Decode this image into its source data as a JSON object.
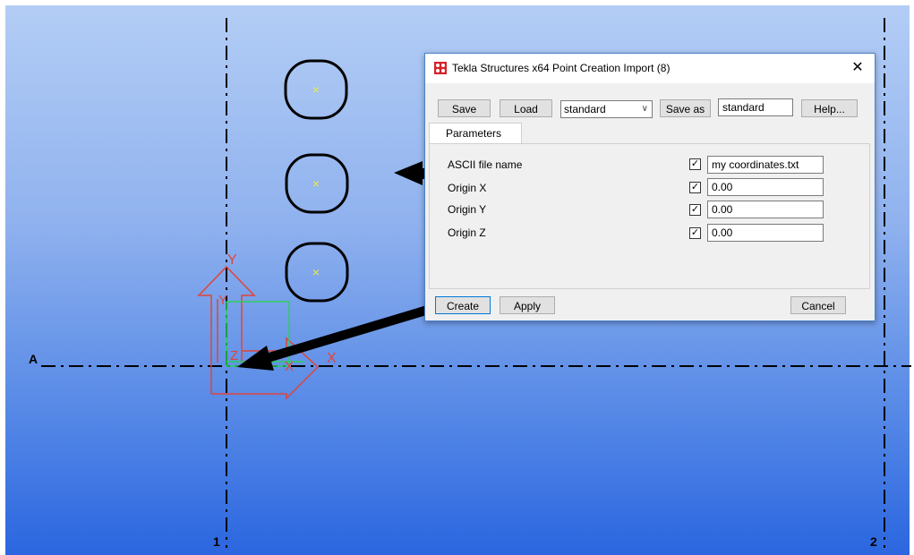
{
  "grid": {
    "axis_a": "A",
    "axis_1": "1",
    "axis_2": "2"
  },
  "coordinate_symbol": {
    "y_label": "Y",
    "x_label": "X",
    "z_label": "Z"
  },
  "points": [
    {
      "marker": "×"
    },
    {
      "marker": "×"
    },
    {
      "marker": "×"
    }
  ],
  "dialog": {
    "title": "Tekla Structures x64  Point Creation Import (8)",
    "close": "✕",
    "toolbar": {
      "save_label": "Save",
      "load_label": "Load",
      "preset_value": "standard",
      "save_as_label": "Save as",
      "save_as_value": "standard",
      "help_label": "Help..."
    },
    "tab": "Parameters",
    "params": [
      {
        "label": "ASCII file name",
        "checked": true,
        "value": "my coordinates.txt"
      },
      {
        "label": "Origin X",
        "checked": true,
        "value": "0.00"
      },
      {
        "label": "Origin Y",
        "checked": true,
        "value": "0.00"
      },
      {
        "label": "Origin Z",
        "checked": true,
        "value": "0.00"
      }
    ],
    "footer": {
      "create_label": "Create",
      "apply_label": "Apply",
      "cancel_label": "Cancel"
    },
    "check_mark": "✓"
  },
  "colors": {
    "accent_border": "#0078d7",
    "symbol_red": "#e0443a",
    "symbol_green": "#2bcf5a",
    "point_marker": "#e8e84a"
  }
}
